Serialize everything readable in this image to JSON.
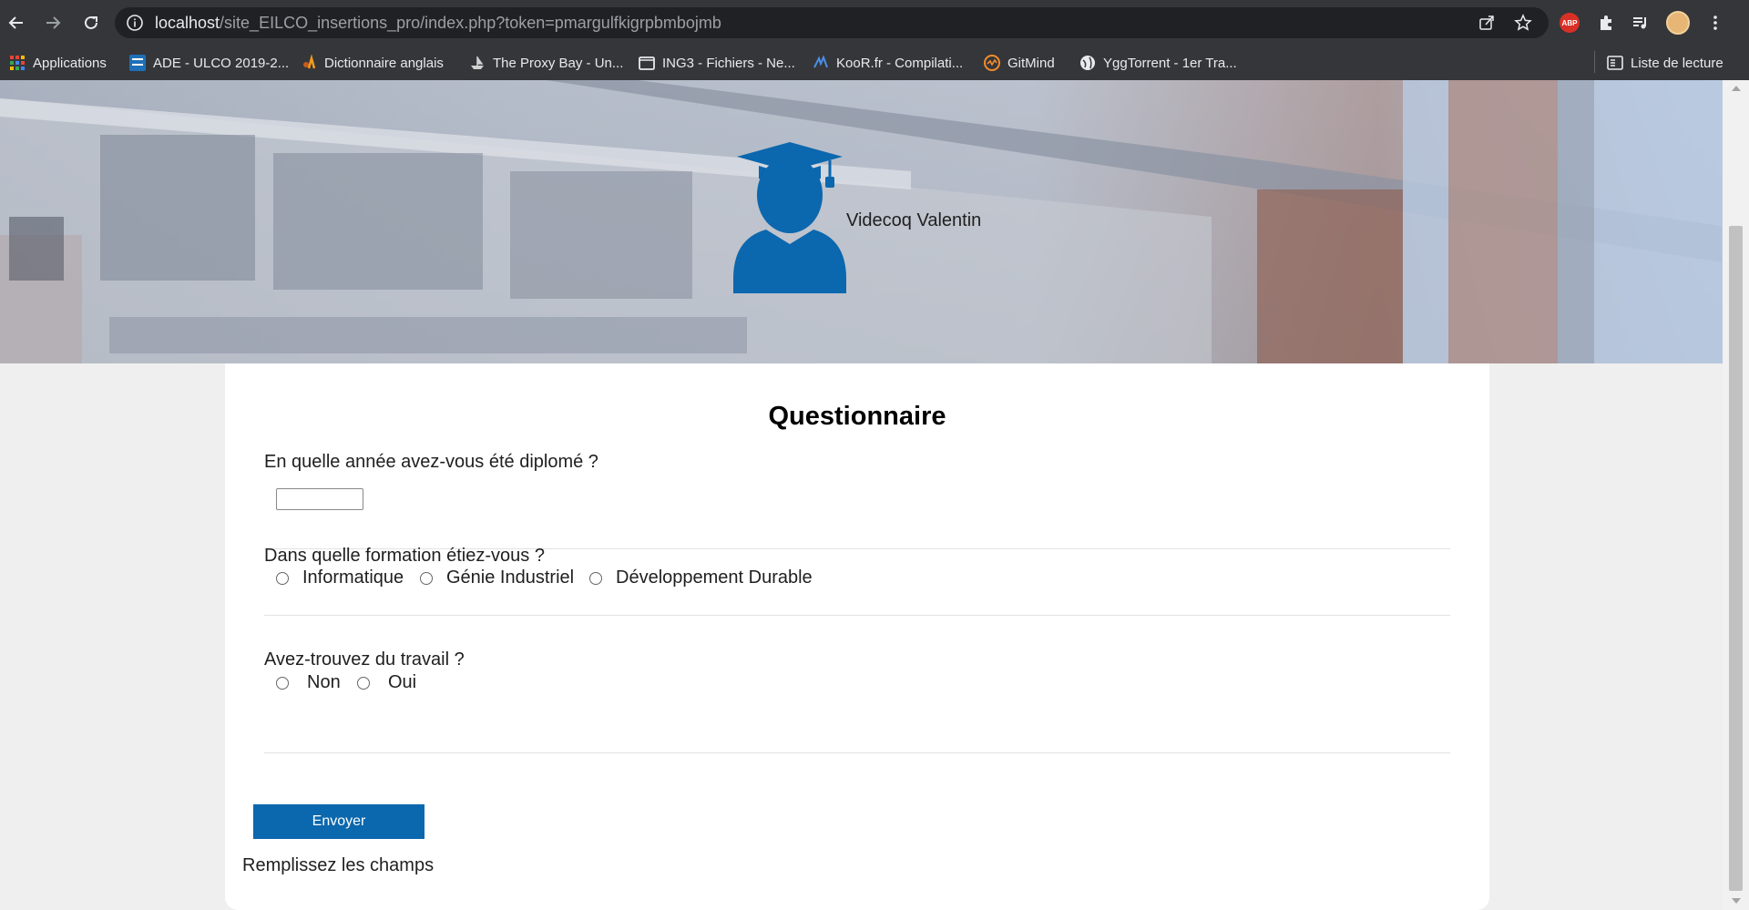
{
  "browser": {
    "url_host": "localhost",
    "url_rest": "/site_EILCO_insertions_pro/index.php?token=pmargulfkigrpbmbojmb",
    "extension_abp_label": "ABP",
    "bookmarks": [
      {
        "label": "Applications",
        "icon": "apps-grid-icon"
      },
      {
        "label": "ADE - ULCO 2019-2...",
        "icon": "ulco-icon"
      },
      {
        "label": "Dictionnaire anglais",
        "icon": "wordreference-icon"
      },
      {
        "label": "The Proxy Bay - Un...",
        "icon": "ship-icon"
      },
      {
        "label": "ING3 - Fichiers - Ne...",
        "icon": "folder-icon"
      },
      {
        "label": "KooR.fr - Compilati...",
        "icon": "koor-icon"
      },
      {
        "label": "GitMind",
        "icon": "gitmind-icon"
      },
      {
        "label": "YggTorrent - 1er Tra...",
        "icon": "globe-icon"
      }
    ],
    "reading_list_label": "Liste de lecture"
  },
  "header": {
    "user_name": "Videcoq Valentin",
    "avatar_icon": "graduate-icon",
    "accent_color": "#0b67ae"
  },
  "form": {
    "title": "Questionnaire",
    "q1": {
      "label": "En quelle année avez-vous été diplomé ?",
      "value": ""
    },
    "q2": {
      "label": "Dans quelle formation étiez-vous ?",
      "options": [
        "Informatique",
        "Génie Industriel",
        "Développement Durable"
      ]
    },
    "q3": {
      "label": "Avez-trouvez du travail ?",
      "options": [
        "Non",
        "Oui"
      ]
    },
    "submit_label": "Envoyer",
    "status_message": "Remplissez les champs"
  }
}
